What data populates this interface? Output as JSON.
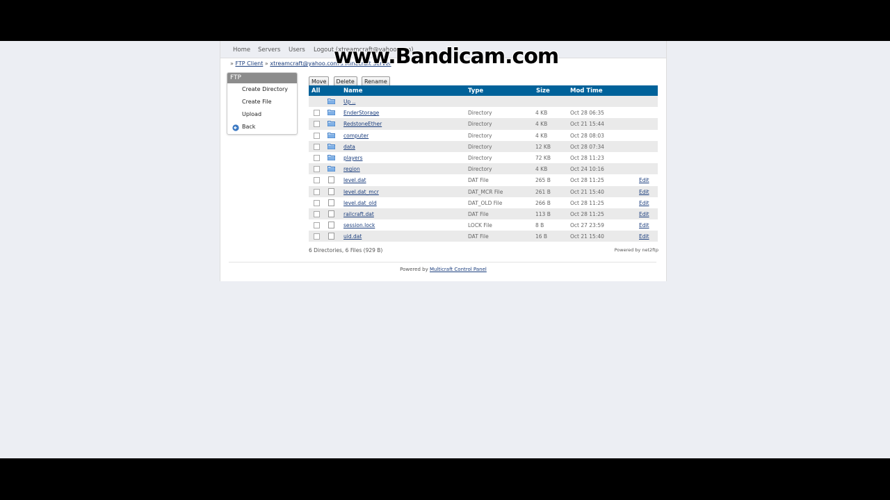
{
  "nav": {
    "home": "Home",
    "servers": "Servers",
    "users": "Users",
    "logout": "Logout (xtreamcraft@yahoo.com)"
  },
  "breadcrumb": {
    "sep": "»",
    "ftp_client": "FTP Client",
    "server": "xtreamcraft@yahoo.com's Minecraft Server"
  },
  "watermark": "www.Bandicam.com",
  "sidebar": {
    "title": "FTP",
    "items": [
      "Create Directory",
      "Create File",
      "Upload",
      "Back"
    ]
  },
  "toolbar": {
    "move": "Move",
    "delete": "Delete",
    "rename": "Rename"
  },
  "table": {
    "headers": {
      "all": "All",
      "name": "Name",
      "type": "Type",
      "size": "Size",
      "mod": "Mod Time"
    },
    "up": "Up ..",
    "rows": [
      {
        "name": "EnderStorage",
        "type": "Directory",
        "size": "4 KB",
        "mod": "Oct 28 06:35",
        "kind": "folder",
        "edit": ""
      },
      {
        "name": "RedstoneEther",
        "type": "Directory",
        "size": "4 KB",
        "mod": "Oct 21 15:44",
        "kind": "folder",
        "edit": ""
      },
      {
        "name": "computer",
        "type": "Directory",
        "size": "4 KB",
        "mod": "Oct 28 08:03",
        "kind": "folder",
        "edit": ""
      },
      {
        "name": "data",
        "type": "Directory",
        "size": "12 KB",
        "mod": "Oct 28 07:34",
        "kind": "folder",
        "edit": ""
      },
      {
        "name": "players",
        "type": "Directory",
        "size": "72 KB",
        "mod": "Oct 28 11:23",
        "kind": "folder",
        "edit": ""
      },
      {
        "name": "region",
        "type": "Directory",
        "size": "4 KB",
        "mod": "Oct 24 10:16",
        "kind": "folder",
        "edit": ""
      },
      {
        "name": "level.dat",
        "type": "DAT File",
        "size": "265 B",
        "mod": "Oct 28 11:25",
        "kind": "file",
        "edit": "Edit"
      },
      {
        "name": "level.dat_mcr",
        "type": "DAT_MCR File",
        "size": "261 B",
        "mod": "Oct 21 15:40",
        "kind": "file",
        "edit": "Edit"
      },
      {
        "name": "level.dat_old",
        "type": "DAT_OLD File",
        "size": "266 B",
        "mod": "Oct 28 11:25",
        "kind": "file",
        "edit": "Edit"
      },
      {
        "name": "railcraft.dat",
        "type": "DAT File",
        "size": "113 B",
        "mod": "Oct 28 11:25",
        "kind": "file",
        "edit": "Edit"
      },
      {
        "name": "session.lock",
        "type": "LOCK File",
        "size": "8 B",
        "mod": "Oct 27 23:59",
        "kind": "file",
        "edit": "Edit"
      },
      {
        "name": "uid.dat",
        "type": "DAT File",
        "size": "16 B",
        "mod": "Oct 21 15:40",
        "kind": "file",
        "edit": "Edit"
      }
    ]
  },
  "summary": "6 Directories, 6 Files (929 B)",
  "powered_net2ftp": "Powered by net2ftp",
  "footer": {
    "prefix": "Powered by ",
    "link": "Multicraft Control Panel"
  },
  "colors": {
    "header_blue": "#00629a",
    "link": "#1a3d7d",
    "folder": "#3a78c2"
  }
}
